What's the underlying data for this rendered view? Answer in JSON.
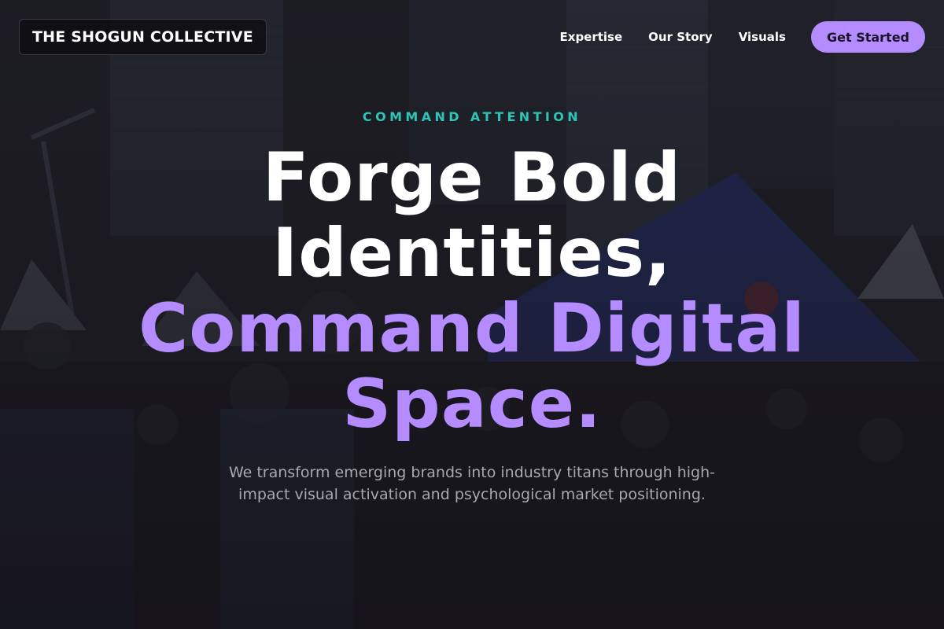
{
  "header": {
    "logo_text": "THE SHOGUN COLLECTIVE",
    "nav": [
      "Expertise",
      "Our Story",
      "Visuals"
    ],
    "cta_label": "Get Started"
  },
  "hero": {
    "eyebrow": "COMMAND ATTENTION",
    "headline_line1": "Forge Bold",
    "headline_line2": "Identities,",
    "headline_line3": "Command Digital",
    "headline_line4": "Space.",
    "subtext": "We transform emerging brands into industry titans through high-impact visual activation and psychological market positioning."
  },
  "colors": {
    "accent_purple": "#b48cff",
    "accent_teal": "#2ec4b6",
    "background": "#18171c"
  }
}
